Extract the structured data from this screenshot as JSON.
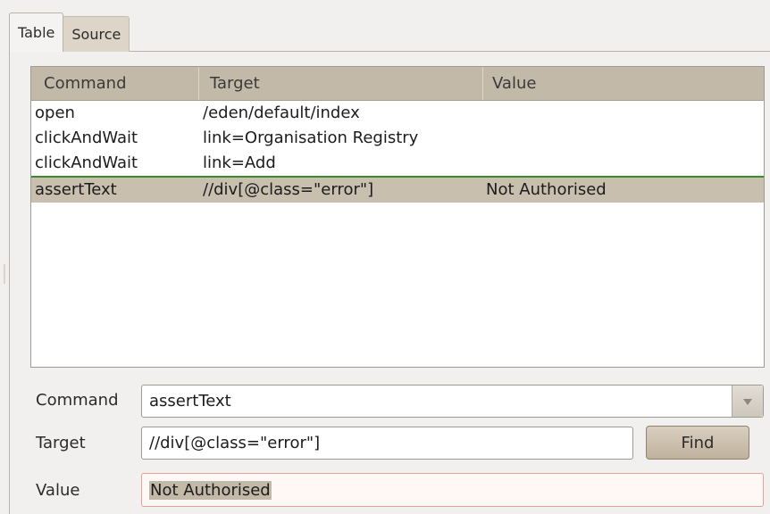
{
  "tabs": [
    {
      "label": "Table",
      "active": true
    },
    {
      "label": "Source",
      "active": false
    }
  ],
  "table": {
    "columns": [
      "Command",
      "Target",
      "Value"
    ],
    "rows": [
      {
        "command": "open",
        "target": "/eden/default/index",
        "value": ""
      },
      {
        "command": "clickAndWait",
        "target": "link=Organisation Registry",
        "value": ""
      },
      {
        "command": "clickAndWait",
        "target": "link=Add",
        "value": ""
      },
      {
        "command": "assertText",
        "target": "//div[@class=\"error\"]",
        "value": "Not Authorised",
        "selected": true
      }
    ]
  },
  "form": {
    "command_label": "Command",
    "command_value": "assertText",
    "target_label": "Target",
    "target_value": "//div[@class=\"error\"]",
    "find_label": "Find",
    "value_label": "Value",
    "value_value": "Not Authorised"
  },
  "icons": {
    "dropdown": "chevron-down-icon"
  },
  "colors": {
    "header_bg": "#c3b9a8",
    "selected_row_bg": "#c9bfae",
    "drop_indicator": "#3c8a2c",
    "value_border": "#e4a197"
  }
}
